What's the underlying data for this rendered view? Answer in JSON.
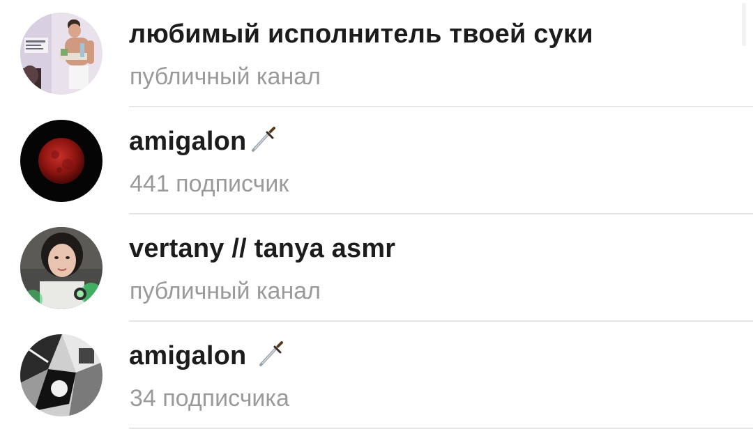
{
  "channels": [
    {
      "title": "любимый исполнитель твоей суки",
      "subtitle": "публичный канал",
      "avatar": "bedroom-photo-avatar",
      "emoji": ""
    },
    {
      "title": "amigalon",
      "subtitle": "441 подписчик",
      "avatar": "red-moon-avatar",
      "emoji": "dagger-icon"
    },
    {
      "title": "vertany // tanya asmr",
      "subtitle": "публичный канал",
      "avatar": "girl-portrait-avatar",
      "emoji": ""
    },
    {
      "title": "amigalon",
      "subtitle": "34 подписчика",
      "avatar": "bw-collage-avatar",
      "emoji": "dagger-icon"
    }
  ],
  "colors": {
    "title": "#1c1c1c",
    "subtitle": "#9a9a9a",
    "divider": "#e6e6e6"
  }
}
